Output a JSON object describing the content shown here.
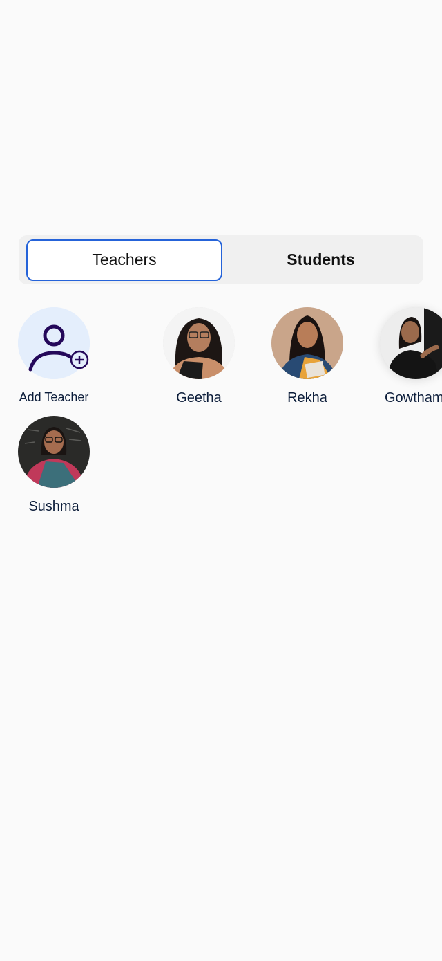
{
  "tabs": {
    "teachers_label": "Teachers",
    "students_label": "Students",
    "active": "Teachers"
  },
  "teachers": {
    "add_label": "Add Teacher",
    "items": [
      {
        "name": "Geetha"
      },
      {
        "name": "Rekha"
      },
      {
        "name": "Gowthami"
      },
      {
        "name": "Sushma"
      }
    ]
  },
  "colors": {
    "accent": "#2563d9",
    "add_bg": "#e4eefc",
    "icon_purple": "#24085a",
    "text": "#0c1d3a"
  }
}
